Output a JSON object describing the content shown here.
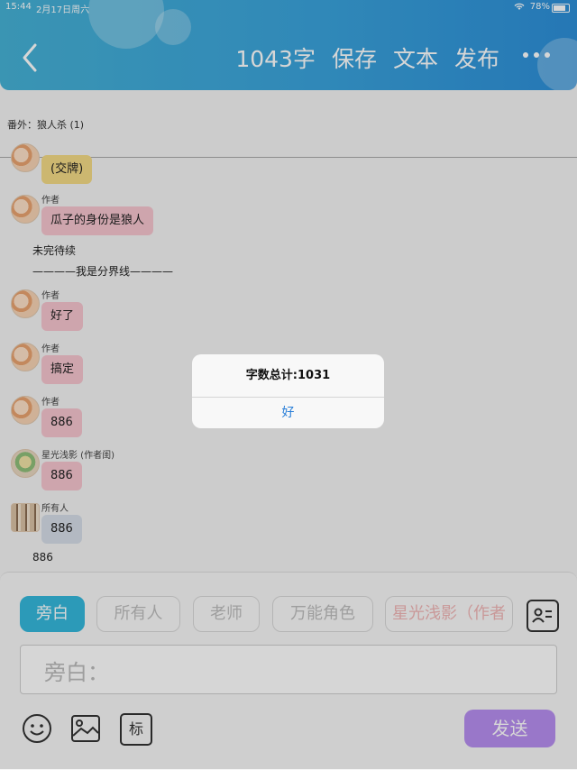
{
  "status_bar": {
    "time": "15:44",
    "date": "2月17日周六",
    "battery": "78%"
  },
  "header": {
    "word_count": "1043字",
    "save": "保存",
    "text": "文本",
    "publish": "发布"
  },
  "chapter": {
    "title": "番外：狼人杀 (1)"
  },
  "messages": [
    {
      "text": "(交牌)",
      "color": "#f4da86"
    },
    {
      "who": "作者",
      "text": "瓜子的身份是狼人",
      "color": "#f6c5cf"
    },
    {
      "plain1": "未完待续"
    },
    {
      "plain2": "————我是分界线————"
    },
    {
      "who": "作者",
      "text": "好了",
      "color": "#f6c5cf"
    },
    {
      "who": "作者",
      "text": "搞定",
      "color": "#f6c5cf"
    },
    {
      "who": "作者",
      "text": "886",
      "color": "#f6c5cf"
    },
    {
      "who": "星光浅影 (作者闺)",
      "text": "886",
      "color": "#f6c5cf"
    },
    {
      "who": "所有人",
      "text": "886",
      "color": "#d6dde7"
    },
    {
      "plain": "886"
    }
  ],
  "roles": [
    "旁白",
    "所有人",
    "老师",
    "万能角色",
    "星光浅影（作者"
  ],
  "input": {
    "prefix": "旁白："
  },
  "toolbar": {
    "tag_label": "标",
    "send_label": "发送"
  },
  "dialog": {
    "title": "字数总计:1031",
    "ok": "好"
  },
  "colors": {
    "header": "#3aa3dc",
    "active_chip": "#35b8dc",
    "send": "#b78ef0",
    "dialog_button": "#2a7fd8"
  }
}
